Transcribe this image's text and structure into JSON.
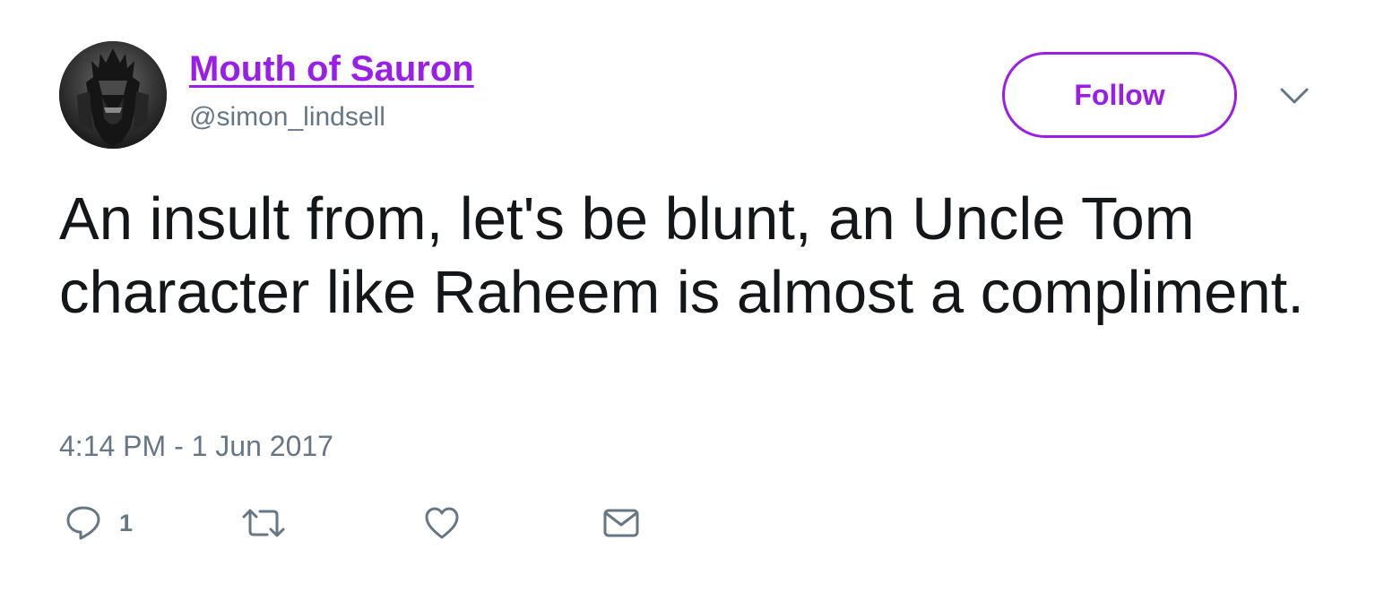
{
  "user": {
    "display_name": "Mouth of Sauron",
    "handle": "@simon_lindsell",
    "avatar_icon": "helmeted-figure-avatar"
  },
  "header": {
    "follow_label": "Follow",
    "menu_icon": "chevron-down-icon"
  },
  "tweet": {
    "text": "An insult from, let's be blunt, an Uncle Tom character like Raheem is almost a compliment.",
    "timestamp": "4:14 PM - 1 Jun 2017"
  },
  "actions": {
    "reply_icon": "reply-icon",
    "reply_count": "1",
    "retweet_icon": "retweet-icon",
    "like_icon": "heart-icon",
    "message_icon": "envelope-icon"
  },
  "colors": {
    "accent": "#9b1de8",
    "text": "#14171a",
    "muted": "#657786"
  }
}
